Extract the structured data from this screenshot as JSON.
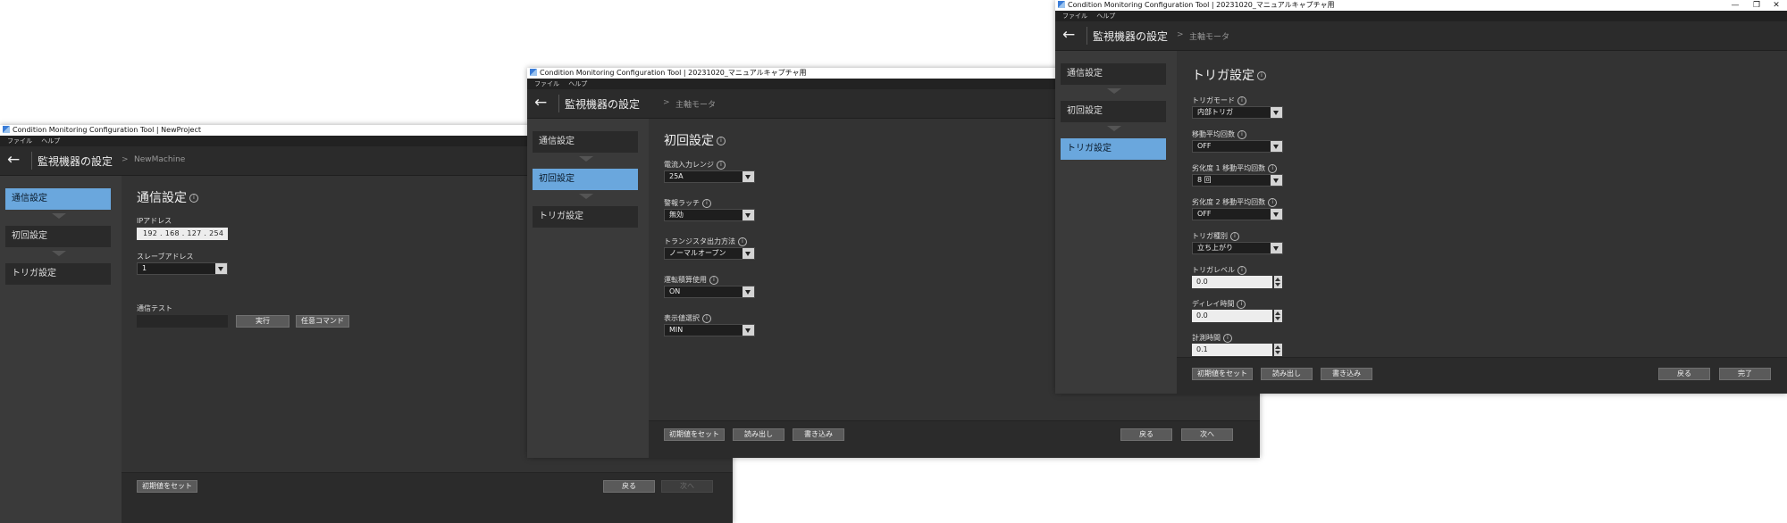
{
  "windows": [
    {
      "title": "Condition Monitoring Configuration Tool | NewProject",
      "menu": [
        "ファイル",
        "ヘルプ"
      ],
      "header": {
        "title": "監視機器の設定",
        "breadcrumb": "NewMachine"
      },
      "sidebar": [
        {
          "label": "通信設定",
          "active": true
        },
        {
          "label": "初回設定",
          "active": false
        },
        {
          "label": "トリガ設定",
          "active": false
        }
      ],
      "section_title": "通信設定",
      "fields": {
        "ip_label": "IPアドレス",
        "ip_value": "192 . 168 . 127 . 254",
        "slave_label": "スレーブアドレス",
        "slave_value": "1",
        "test_label": "通信テスト",
        "run_button": "実行",
        "arbitrary_button": "任意コマンド"
      },
      "footer": {
        "reset": "初期値をセット",
        "back": "戻る",
        "next": "次へ"
      }
    },
    {
      "title": "Condition Monitoring Configuration Tool | 20231020_マニュアルキャプチャ用",
      "menu": [
        "ファイル",
        "ヘルプ"
      ],
      "header": {
        "title": "監視機器の設定",
        "breadcrumb": "主軸モータ"
      },
      "sidebar": [
        {
          "label": "通信設定",
          "active": false
        },
        {
          "label": "初回設定",
          "active": true
        },
        {
          "label": "トリガ設定",
          "active": false
        }
      ],
      "section_title": "初回設定",
      "fields": [
        {
          "label": "電流入力レンジ",
          "value": "25A"
        },
        {
          "label": "警報ラッチ",
          "value": "無効"
        },
        {
          "label": "トランジスタ出力方法",
          "value": "ノーマルオープン"
        },
        {
          "label": "運転積算使用",
          "value": "ON"
        },
        {
          "label": "表示値選択",
          "value": "MIN"
        }
      ],
      "footer": {
        "reset": "初期値をセット",
        "read": "読み出し",
        "write": "書き込み",
        "back": "戻る",
        "next": "次へ"
      }
    },
    {
      "title": "Condition Monitoring Configuration Tool | 20231020_マニュアルキャプチャ用",
      "menu": [
        "ファイル",
        "ヘルプ"
      ],
      "window_controls": [
        "—",
        "❐",
        "✕"
      ],
      "header": {
        "title": "監視機器の設定",
        "breadcrumb": "主軸モータ"
      },
      "sidebar": [
        {
          "label": "通信設定",
          "active": false
        },
        {
          "label": "初回設定",
          "active": false
        },
        {
          "label": "トリガ設定",
          "active": true
        }
      ],
      "section_title": "トリガ設定",
      "fields": [
        {
          "label": "トリガモード",
          "value": "内部トリガ",
          "kind": "select"
        },
        {
          "label": "移動平均回数",
          "value": "OFF",
          "kind": "select"
        },
        {
          "label": "劣化度 1 移動平均回数",
          "value": "8 回",
          "kind": "select"
        },
        {
          "label": "劣化度 2 移動平均回数",
          "value": "OFF",
          "kind": "select"
        },
        {
          "label": "トリガ種別",
          "value": "立ち上がり",
          "kind": "select"
        },
        {
          "label": "トリガレベル",
          "value": "0.0",
          "kind": "spin"
        },
        {
          "label": "ディレイ時間",
          "value": "0.0",
          "kind": "spin"
        },
        {
          "label": "計測時間",
          "value": "0.1",
          "kind": "spin"
        }
      ],
      "footer": {
        "reset": "初期値をセット",
        "read": "読み出し",
        "write": "書き込み",
        "back": "戻る",
        "done": "完了"
      }
    }
  ]
}
